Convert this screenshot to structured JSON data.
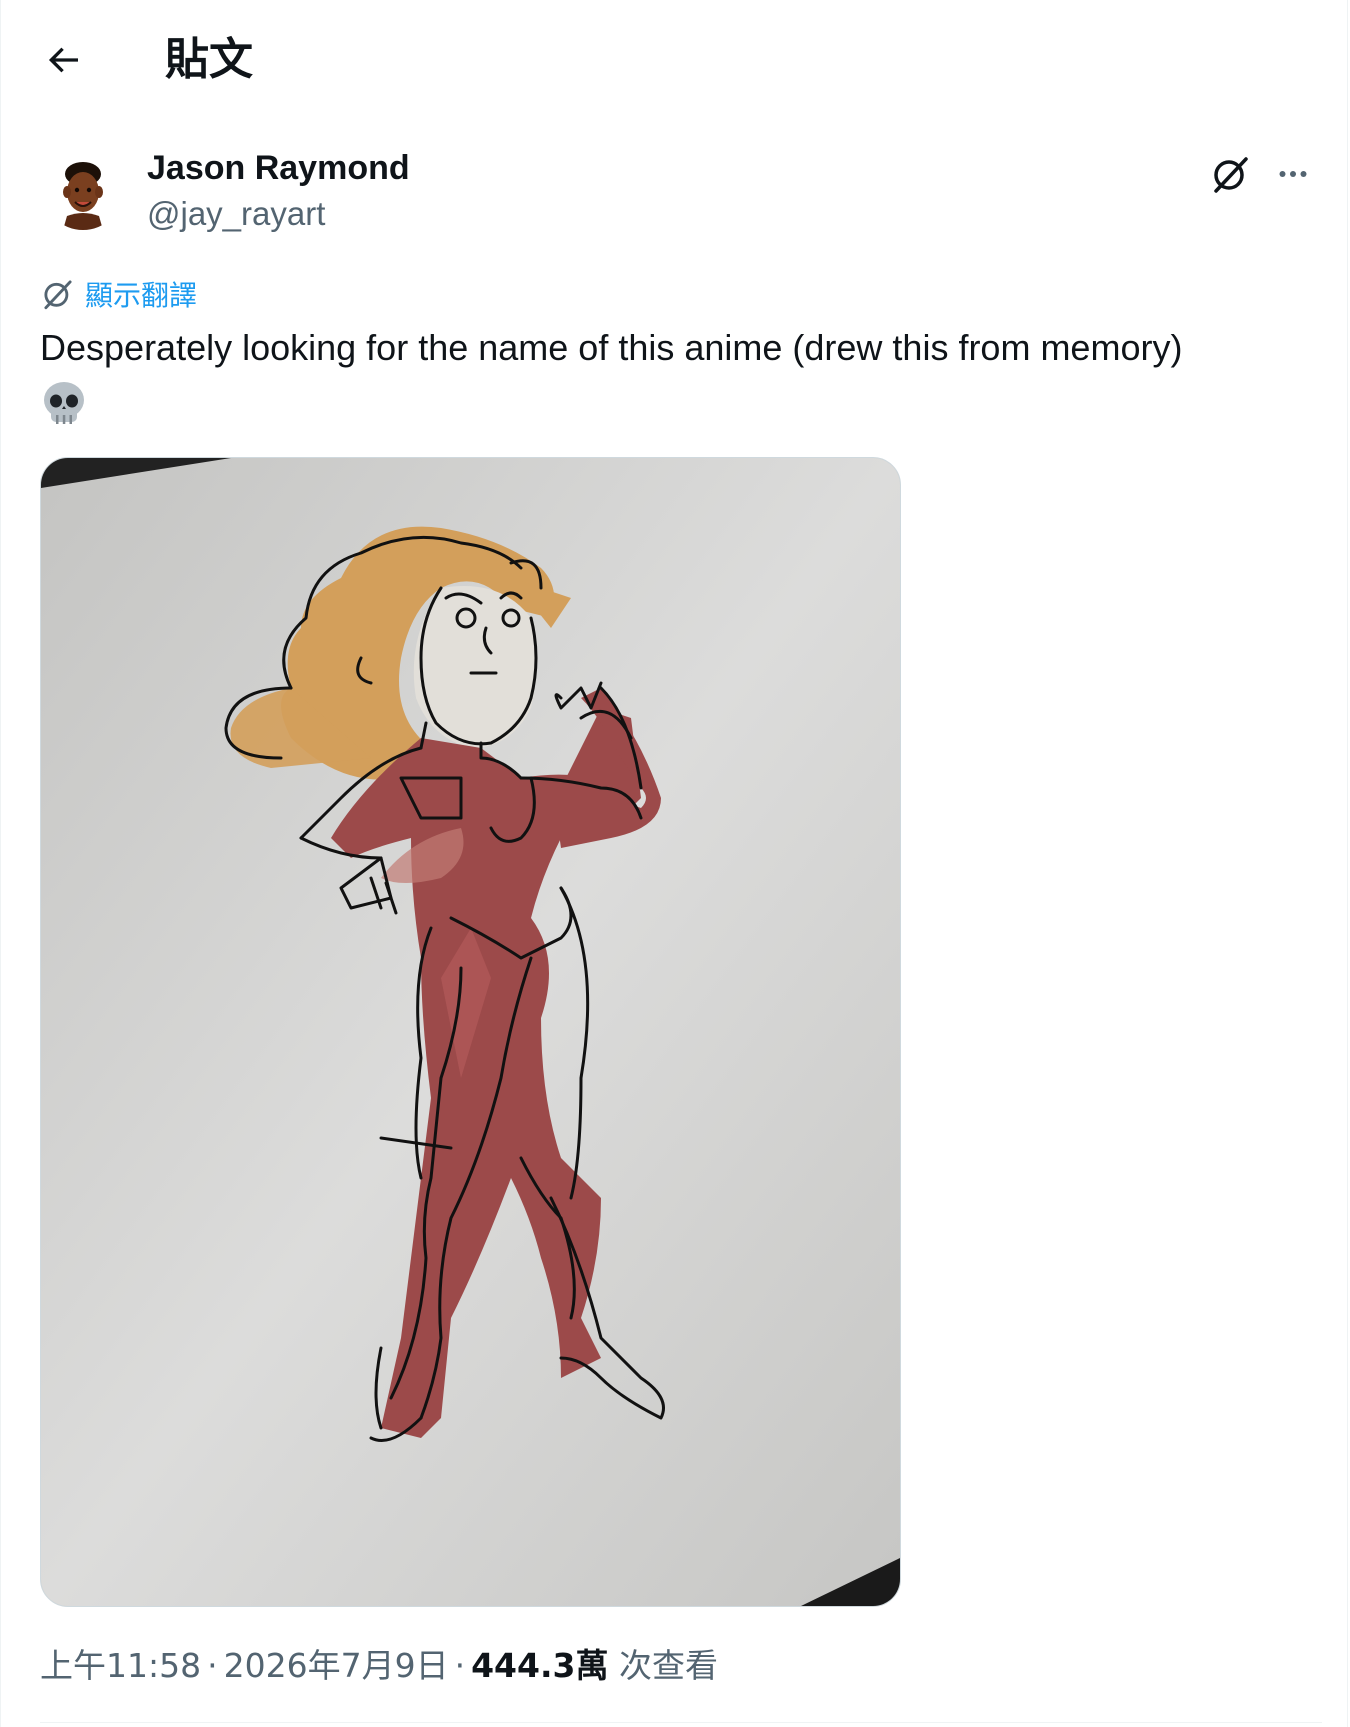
{
  "header": {
    "back_icon": "arrow-left-icon",
    "title": "貼文"
  },
  "author": {
    "name": "Jason Raymond",
    "handle": "@jay_rayart",
    "avatar_icon": "avatar"
  },
  "actions": {
    "grok_icon": "grok-icon",
    "more_icon": "more-horizontal-icon"
  },
  "translate": {
    "icon": "grok-icon",
    "label": "顯示翻譯"
  },
  "tweet": {
    "text": "Desperately looking for the name of this anime (drew this from memory)",
    "emoji": "skull-emoji"
  },
  "media": {
    "type": "image",
    "subject": "sketch-of-woman-in-red-jumpsuit"
  },
  "meta": {
    "time": "上午11:58",
    "separator": "·",
    "date": "2026年7月9日",
    "views_count": "444.3萬",
    "views_label": "次查看"
  },
  "colors": {
    "text_primary": "#0f1419",
    "text_secondary": "#536471",
    "link": "#1d9bf0",
    "border": "#cfd9de",
    "hair": "#d3a05c",
    "suit": "#9b4b4b"
  }
}
